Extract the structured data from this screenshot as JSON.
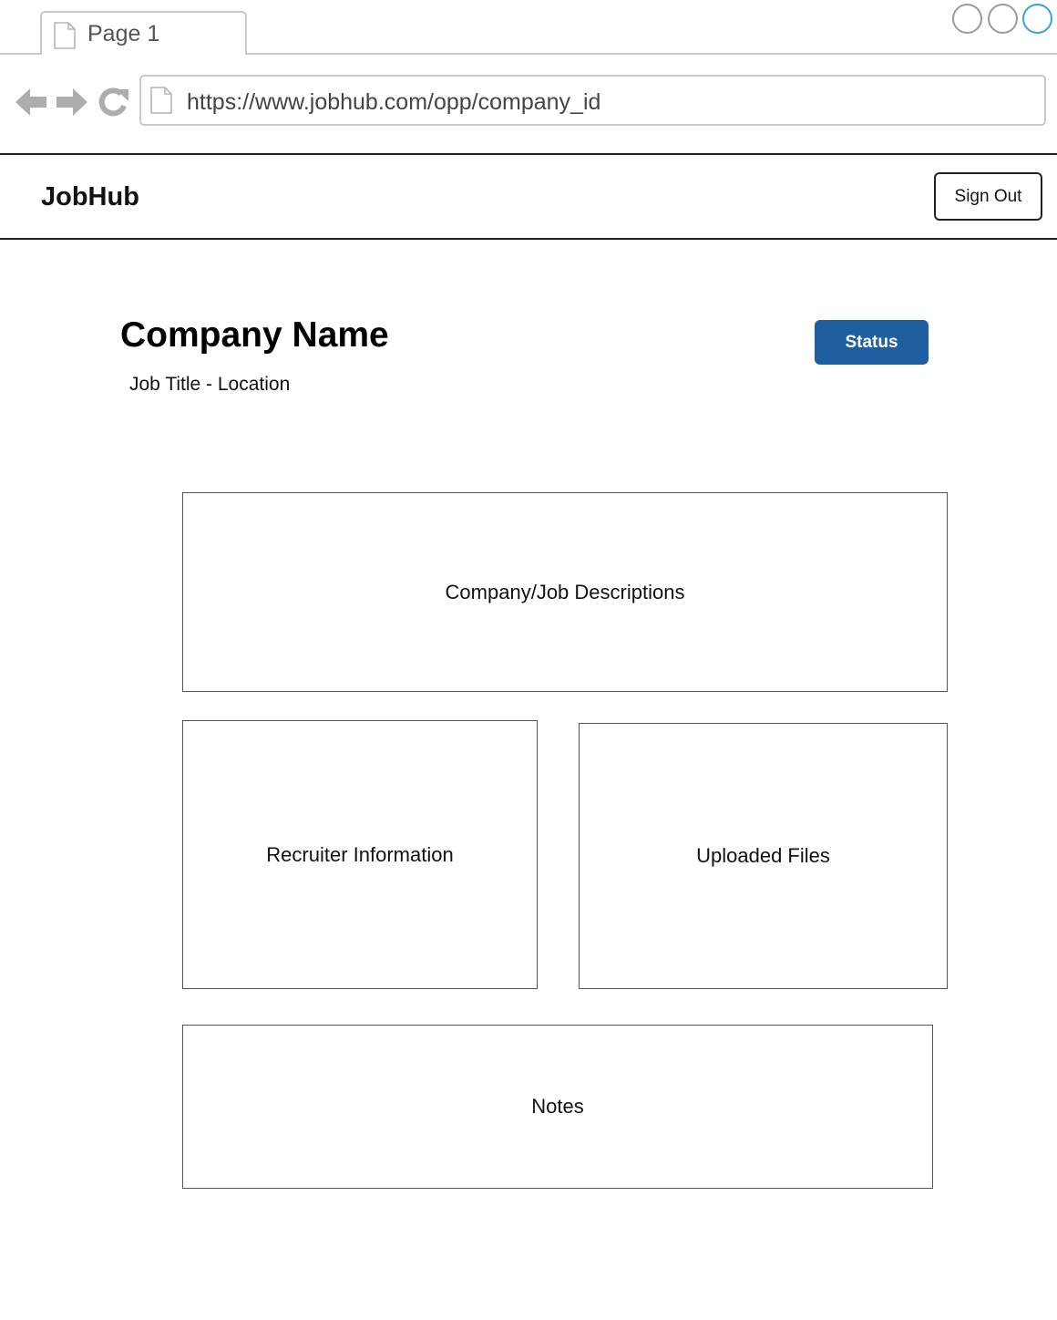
{
  "browser": {
    "tab_title": "Page 1",
    "url": "https://www.jobhub.com/opp/company_id",
    "accent_color": "#3a9ee0"
  },
  "header": {
    "brand": "JobHub",
    "sign_out_label": "Sign Out"
  },
  "page": {
    "company_name": "Company Name",
    "subtitle": "Job Title - Location",
    "status_label": "Status",
    "status_color": "#1f5fa0"
  },
  "panels": {
    "descriptions": "Company/Job Descriptions",
    "recruiter": "Recruiter Information",
    "files": "Uploaded Files",
    "notes": "Notes"
  }
}
